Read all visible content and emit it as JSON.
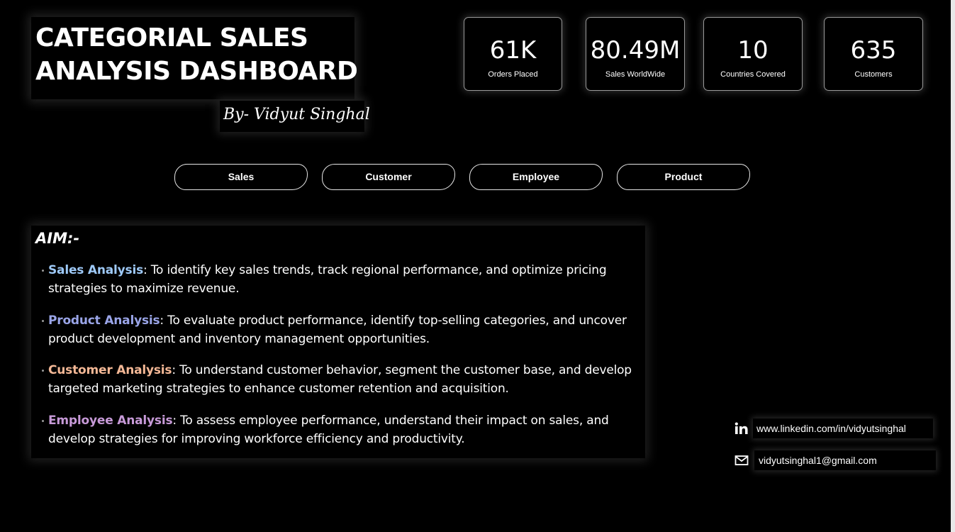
{
  "header": {
    "title": "CATEGORIAL SALES\nANALYSIS DASHBOARD",
    "author": "By- Vidyut Singhal"
  },
  "kpis": [
    {
      "value": "61K",
      "label": "Orders Placed"
    },
    {
      "value": "80.49M",
      "label": "Sales WorldWide"
    },
    {
      "value": "10",
      "label": "Countries Covered"
    },
    {
      "value": "635",
      "label": "Customers"
    }
  ],
  "nav": {
    "tabs": [
      {
        "label": "Sales"
      },
      {
        "label": "Customer"
      },
      {
        "label": "Employee"
      },
      {
        "label": "Product"
      }
    ]
  },
  "aim": {
    "heading": "AIM:-",
    "items": [
      {
        "title": "Sales Analysis",
        "color": "#9ec9f7",
        "text": ": To identify key sales trends, track regional performance, and optimize pricing strategies to maximize revenue."
      },
      {
        "title": "Product Analysis",
        "color": "#9aa5e8",
        "text": ": To evaluate product performance, identify top-selling categories, and uncover product development and inventory management opportunities."
      },
      {
        "title": "Customer Analysis",
        "color": "#f4b896",
        "text": ": To understand customer behavior, segment the customer base, and develop targeted marketing strategies to enhance customer retention and acquisition."
      },
      {
        "title": "Employee Analysis",
        "color": "#c79ad8",
        "text": ": To assess employee performance, understand their impact on sales, and develop strategies for improving workforce efficiency and productivity."
      }
    ]
  },
  "contacts": {
    "linkedin": {
      "text": "www.linkedin.com/in/vidyutsinghal",
      "icon": "linkedin-icon"
    },
    "email": {
      "text": "vidyutsinghal1@gmail.com",
      "icon": "mail-icon"
    }
  },
  "colors": {
    "background": "#000000",
    "text": "#ffffff",
    "card_border": "#9a9a9a"
  }
}
